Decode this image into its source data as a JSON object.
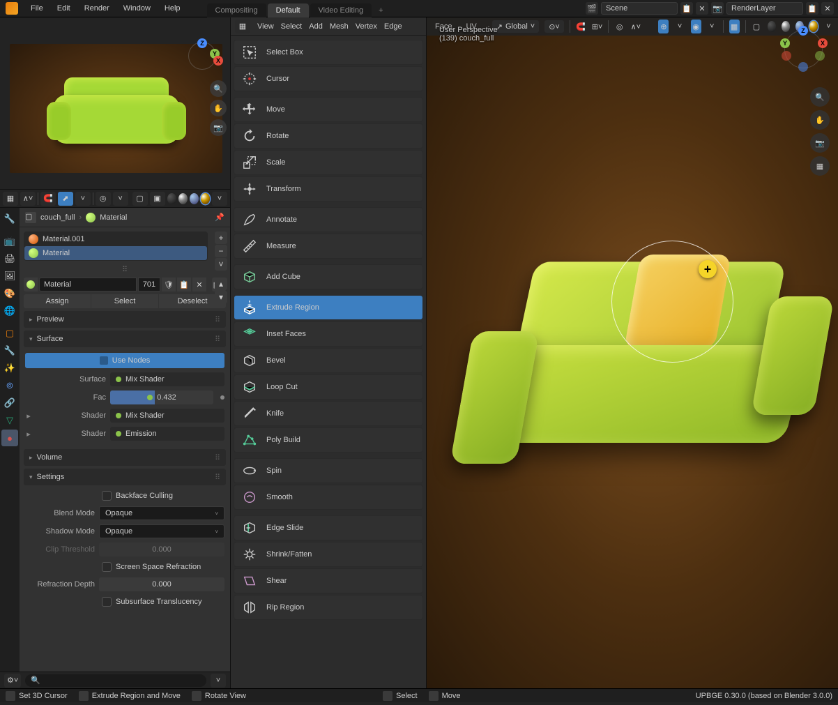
{
  "menu": {
    "file": "File",
    "edit": "Edit",
    "render": "Render",
    "window": "Window",
    "help": "Help"
  },
  "workspaces": {
    "compositing": "Compositing",
    "default": "Default",
    "video": "Video Editing"
  },
  "scene": {
    "label": "Scene",
    "layer": "RenderLayer"
  },
  "viewport_header": {
    "view": "View",
    "select": "Select",
    "add": "Add",
    "mesh": "Mesh",
    "vertex": "Vertex",
    "edge": "Edge",
    "face": "Face",
    "uv": "UV",
    "orientation": "Global"
  },
  "viewport_info": {
    "perspective": "User Perspective",
    "object": "(139) couch_full"
  },
  "breadcrumb": {
    "object": "couch_full",
    "material": "Material"
  },
  "materials": {
    "list": [
      {
        "name": "Material.001"
      },
      {
        "name": "Material"
      }
    ],
    "selected": "Material",
    "users": "701"
  },
  "buttons": {
    "assign": "Assign",
    "select": "Select",
    "deselect": "Deselect"
  },
  "sections": {
    "preview": "Preview",
    "surface": "Surface",
    "volume": "Volume",
    "settings": "Settings"
  },
  "surface": {
    "use_nodes": "Use Nodes",
    "surface_label": "Surface",
    "surface_val": "Mix Shader",
    "fac_label": "Fac",
    "fac_val": "0.432",
    "shader1_label": "Shader",
    "shader1_val": "Mix Shader",
    "shader2_label": "Shader",
    "shader2_val": "Emission"
  },
  "settings_panel": {
    "backface": "Backface Culling",
    "blend_label": "Blend Mode",
    "blend_val": "Opaque",
    "shadow_label": "Shadow Mode",
    "shadow_val": "Opaque",
    "clip_label": "Clip Threshold",
    "clip_val": "0.000",
    "ssr": "Screen Space Refraction",
    "refr_label": "Refraction Depth",
    "refr_val": "0.000",
    "sss": "Subsurface Translucency"
  },
  "tools": {
    "select_box": "Select Box",
    "cursor": "Cursor",
    "move": "Move",
    "rotate": "Rotate",
    "scale": "Scale",
    "transform": "Transform",
    "annotate": "Annotate",
    "measure": "Measure",
    "add_cube": "Add Cube",
    "extrude": "Extrude Region",
    "inset": "Inset Faces",
    "bevel": "Bevel",
    "loop_cut": "Loop Cut",
    "knife": "Knife",
    "poly_build": "Poly Build",
    "spin": "Spin",
    "smooth": "Smooth",
    "edge_slide": "Edge Slide",
    "shrink": "Shrink/Fatten",
    "shear": "Shear",
    "rip": "Rip Region"
  },
  "statusbar": {
    "cursor": "Set 3D Cursor",
    "extrude": "Extrude Region and Move",
    "rotate": "Rotate View",
    "select": "Select",
    "move": "Move",
    "version": "UPBGE 0.30.0 (based on Blender 3.0.0)"
  }
}
